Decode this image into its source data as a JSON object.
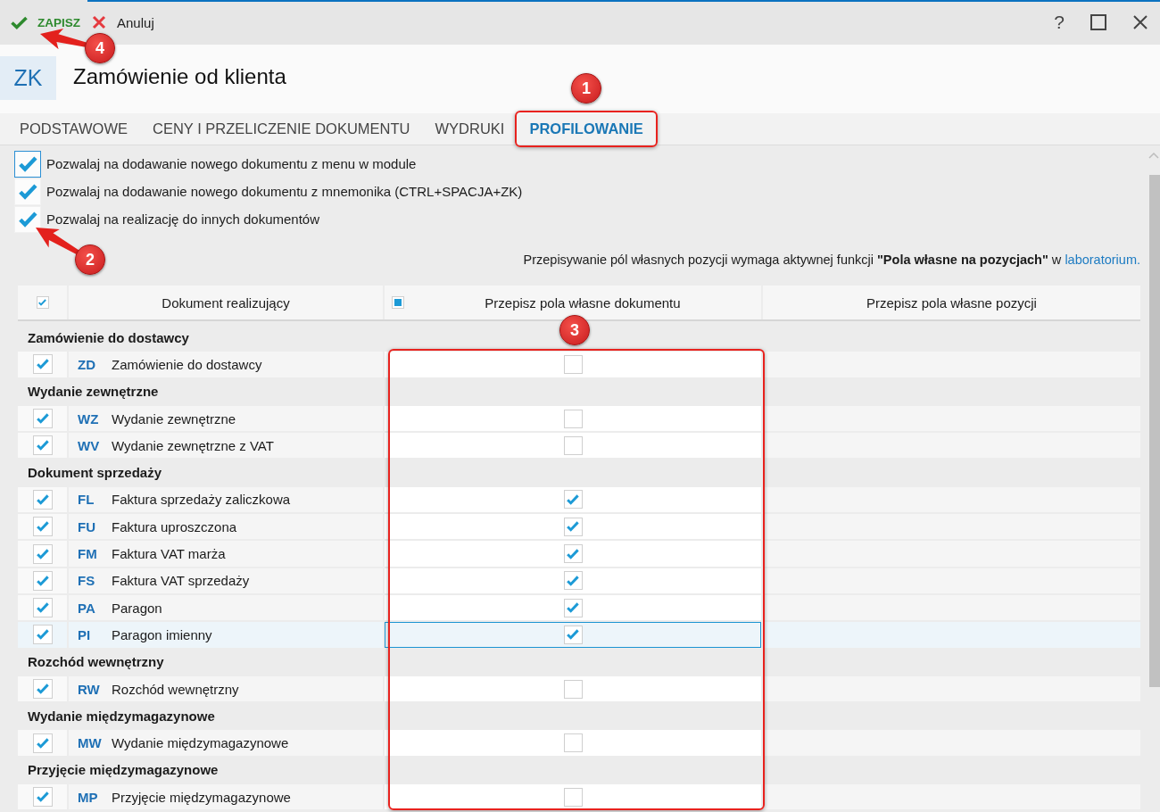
{
  "toolbar": {
    "save": {
      "label": "ZAPISZ",
      "callout": "4"
    },
    "cancel": {
      "label": "Anuluj"
    },
    "help": "?"
  },
  "document": {
    "badge": "ZK",
    "title": "Zamówienie od klienta"
  },
  "tabs": [
    {
      "label": "PODSTAWOWE",
      "selected": false
    },
    {
      "label": "CENY I PRZELICZENIE DOKUMENTU",
      "selected": false
    },
    {
      "label": "WYDRUKI",
      "selected": false
    },
    {
      "label": "PROFILOWANIE",
      "selected": true,
      "callout": "1"
    }
  ],
  "options": [
    {
      "label": "Pozwalaj na dodawanie nowego dokumentu z menu w module",
      "checked": true,
      "focused": true
    },
    {
      "label": "Pozwalaj na dodawanie nowego dokumentu z mnemonika (CTRL+SPACJA+ZK)",
      "checked": true,
      "focused": false
    },
    {
      "label": "Pozwalaj na realizację do innych dokumentów",
      "checked": true,
      "focused": false,
      "callout": "2"
    }
  ],
  "notice": {
    "text": "Przepisywanie pól własnych pozycji wymaga aktywnej funkcji **\"Pola własne na pozycjach\"** w",
    "link": "laboratorium."
  },
  "table": {
    "columns": [
      {
        "kind": "checkbox",
        "checked": true
      },
      {
        "kind": "text",
        "label": "Dokument realizujący"
      },
      {
        "kind": "checkbox_text",
        "label": "Przepisz pola własne dokumentu",
        "indeterminate": true,
        "callout": "3"
      },
      {
        "kind": "text",
        "label": "Przepisz pola własne pozycji"
      }
    ],
    "groups": [
      {
        "title": "Zamówienie do dostawcy",
        "rows": [
          {
            "code": "ZD",
            "name": "Zamówienie do dostawcy",
            "checked": true,
            "copy_document_fields": false,
            "selected": false
          }
        ]
      },
      {
        "title": "Wydanie zewnętrzne",
        "rows": [
          {
            "code": "WZ",
            "name": "Wydanie zewnętrzne",
            "checked": true,
            "copy_document_fields": false,
            "selected": false
          },
          {
            "code": "WV",
            "name": "Wydanie zewnętrzne z VAT",
            "checked": true,
            "copy_document_fields": false,
            "selected": false
          }
        ]
      },
      {
        "title": "Dokument sprzedaży",
        "rows": [
          {
            "code": "FL",
            "name": "Faktura sprzedaży zaliczkowa",
            "checked": true,
            "copy_document_fields": true,
            "selected": false
          },
          {
            "code": "FU",
            "name": "Faktura uproszczona",
            "checked": true,
            "copy_document_fields": true,
            "selected": false
          },
          {
            "code": "FM",
            "name": "Faktura VAT marża",
            "checked": true,
            "copy_document_fields": true,
            "selected": false
          },
          {
            "code": "FS",
            "name": "Faktura VAT sprzedaży",
            "checked": true,
            "copy_document_fields": true,
            "selected": false
          },
          {
            "code": "PA",
            "name": "Paragon",
            "checked": true,
            "copy_document_fields": true,
            "selected": false
          },
          {
            "code": "PI",
            "name": "Paragon imienny",
            "checked": true,
            "copy_document_fields": true,
            "selected": true
          }
        ]
      },
      {
        "title": "Rozchód wewnętrzny",
        "rows": [
          {
            "code": "RW",
            "name": "Rozchód wewnętrzny",
            "checked": true,
            "copy_document_fields": false,
            "selected": false
          }
        ]
      },
      {
        "title": "Wydanie międzymagazynowe",
        "rows": [
          {
            "code": "MW",
            "name": "Wydanie międzymagazynowe",
            "checked": true,
            "copy_document_fields": false,
            "selected": false
          }
        ]
      },
      {
        "title": "Przyjęcie międzymagazynowe",
        "rows": [
          {
            "code": "MP",
            "name": "Przyjęcie międzymagazynowe",
            "checked": true,
            "copy_document_fields": false,
            "selected": false
          }
        ]
      }
    ]
  }
}
